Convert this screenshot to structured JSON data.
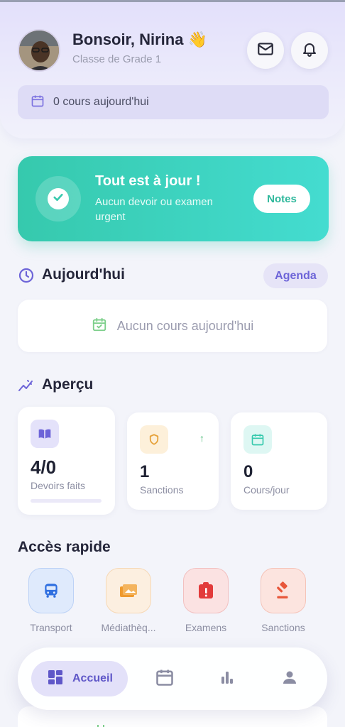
{
  "header": {
    "greeting": "Bonsoir, Nirina",
    "greeting_emoji": "👋",
    "subtitle": "Classe de Grade 1",
    "today_pill": "0 cours aujourd'hui",
    "mail_icon": "mail-icon",
    "bell_icon": "bell-icon"
  },
  "banner": {
    "title": "Tout est à jour !",
    "subtitle": "Aucun devoir ou examen urgent",
    "button": "Notes"
  },
  "today": {
    "title": "Aujourd'hui",
    "agenda_button": "Agenda",
    "empty_text": "Aucun cours aujourd'hui"
  },
  "overview": {
    "title": "Aperçu",
    "stats": [
      {
        "value": "4/0",
        "label": "Devoirs faits",
        "icon": "book-icon",
        "progress": 0
      },
      {
        "value": "1",
        "label": "Sanctions",
        "icon": "shield-icon",
        "trend": "↑"
      },
      {
        "value": "0",
        "label": "Cours/jour",
        "icon": "calendar-icon"
      }
    ]
  },
  "quick_access": {
    "title": "Accès rapide",
    "items": [
      {
        "label": "Transport",
        "icon": "bus-icon"
      },
      {
        "label": "Médiathèq...",
        "icon": "media-icon"
      },
      {
        "label": "Examens",
        "icon": "exam-icon"
      },
      {
        "label": "Sanctions",
        "icon": "gavel-icon"
      }
    ]
  },
  "bottom_nav": {
    "active_label": "Accueil",
    "items": [
      "home-icon",
      "calendar-icon",
      "stats-icon",
      "profile-icon"
    ]
  },
  "colors": {
    "accent": "#6d64d8",
    "success": "#36c9ad",
    "header_bg": "#e3e0fb"
  }
}
